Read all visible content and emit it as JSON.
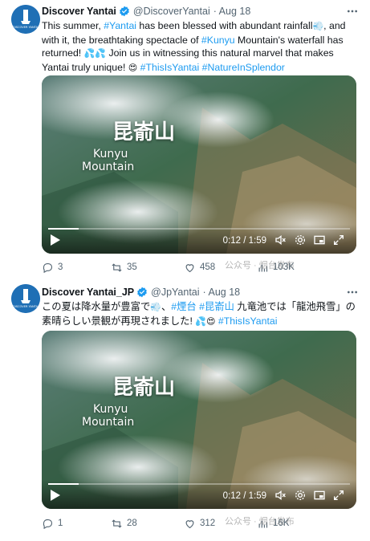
{
  "tweets": [
    {
      "name": "Discover Yantai",
      "handle": "@DiscoverYantai",
      "date": "· Aug 18",
      "avatar_text": "DISCOVER YANTAI",
      "text_segments": [
        {
          "t": "This summer, ",
          "k": "plain"
        },
        {
          "t": "#Yantai",
          "k": "link"
        },
        {
          "t": " has been blessed with abundant rainfall",
          "k": "plain"
        },
        {
          "t": "💨",
          "k": "emoji"
        },
        {
          "t": ", and with it, the breathtaking spectacle of ",
          "k": "plain"
        },
        {
          "t": "#Kunyu",
          "k": "link"
        },
        {
          "t": " Mountain's waterfall has returned! ",
          "k": "plain"
        },
        {
          "t": "💦💦",
          "k": "emoji"
        },
        {
          "t": " Join us in witnessing this natural marvel that makes Yantai truly unique! ",
          "k": "plain"
        },
        {
          "t": "😍",
          "k": "emoji"
        },
        {
          "t": " #ThisIsYantai #NatureInSplendor",
          "k": "link"
        }
      ],
      "video": {
        "title_cn": "昆嵛山",
        "title_en_1": "Kunyu",
        "title_en_2": "Mountain",
        "time": "0:12 / 1:59",
        "progress": 0.1
      },
      "stats": {
        "replies": "3",
        "retweets": "35",
        "likes": "458",
        "views": "103K"
      },
      "watermark": "公众号 · 烟台发布"
    },
    {
      "name": "Discover Yantai_JP",
      "handle": "@JpYantai",
      "date": "· Aug 18",
      "avatar_text": "DISCOVER YANTAI",
      "text_segments": [
        {
          "t": "この夏は降水量が豊富で",
          "k": "plain"
        },
        {
          "t": "💨",
          "k": "emoji"
        },
        {
          "t": "、",
          "k": "plain"
        },
        {
          "t": "#煙台 #昆嵛山",
          "k": "link"
        },
        {
          "t": " 九竜池では「龍池飛雪」の素晴らしい景観が再現されました! ",
          "k": "plain"
        },
        {
          "t": "💦😍",
          "k": "emoji"
        },
        {
          "t": " #ThisIsYantai",
          "k": "link"
        }
      ],
      "video": {
        "title_cn": "昆嵛山",
        "title_en_1": "Kunyu",
        "title_en_2": "Mountain",
        "time": "0:12 / 1:59",
        "progress": 0.1
      },
      "stats": {
        "replies": "1",
        "retweets": "28",
        "likes": "312",
        "views": "16K"
      },
      "watermark": "公众号 · 烟台发布"
    }
  ],
  "colors": {
    "link": "#1d9bf0",
    "muted": "#536471",
    "verified": "#1d9bf0",
    "avatar": "#1f6fb5"
  },
  "icons": [
    "verified-icon",
    "more-icon",
    "play-icon",
    "volume-icon",
    "settings-icon",
    "pip-icon",
    "fullscreen-icon",
    "reply-icon",
    "retweet-icon",
    "like-icon",
    "views-icon"
  ]
}
